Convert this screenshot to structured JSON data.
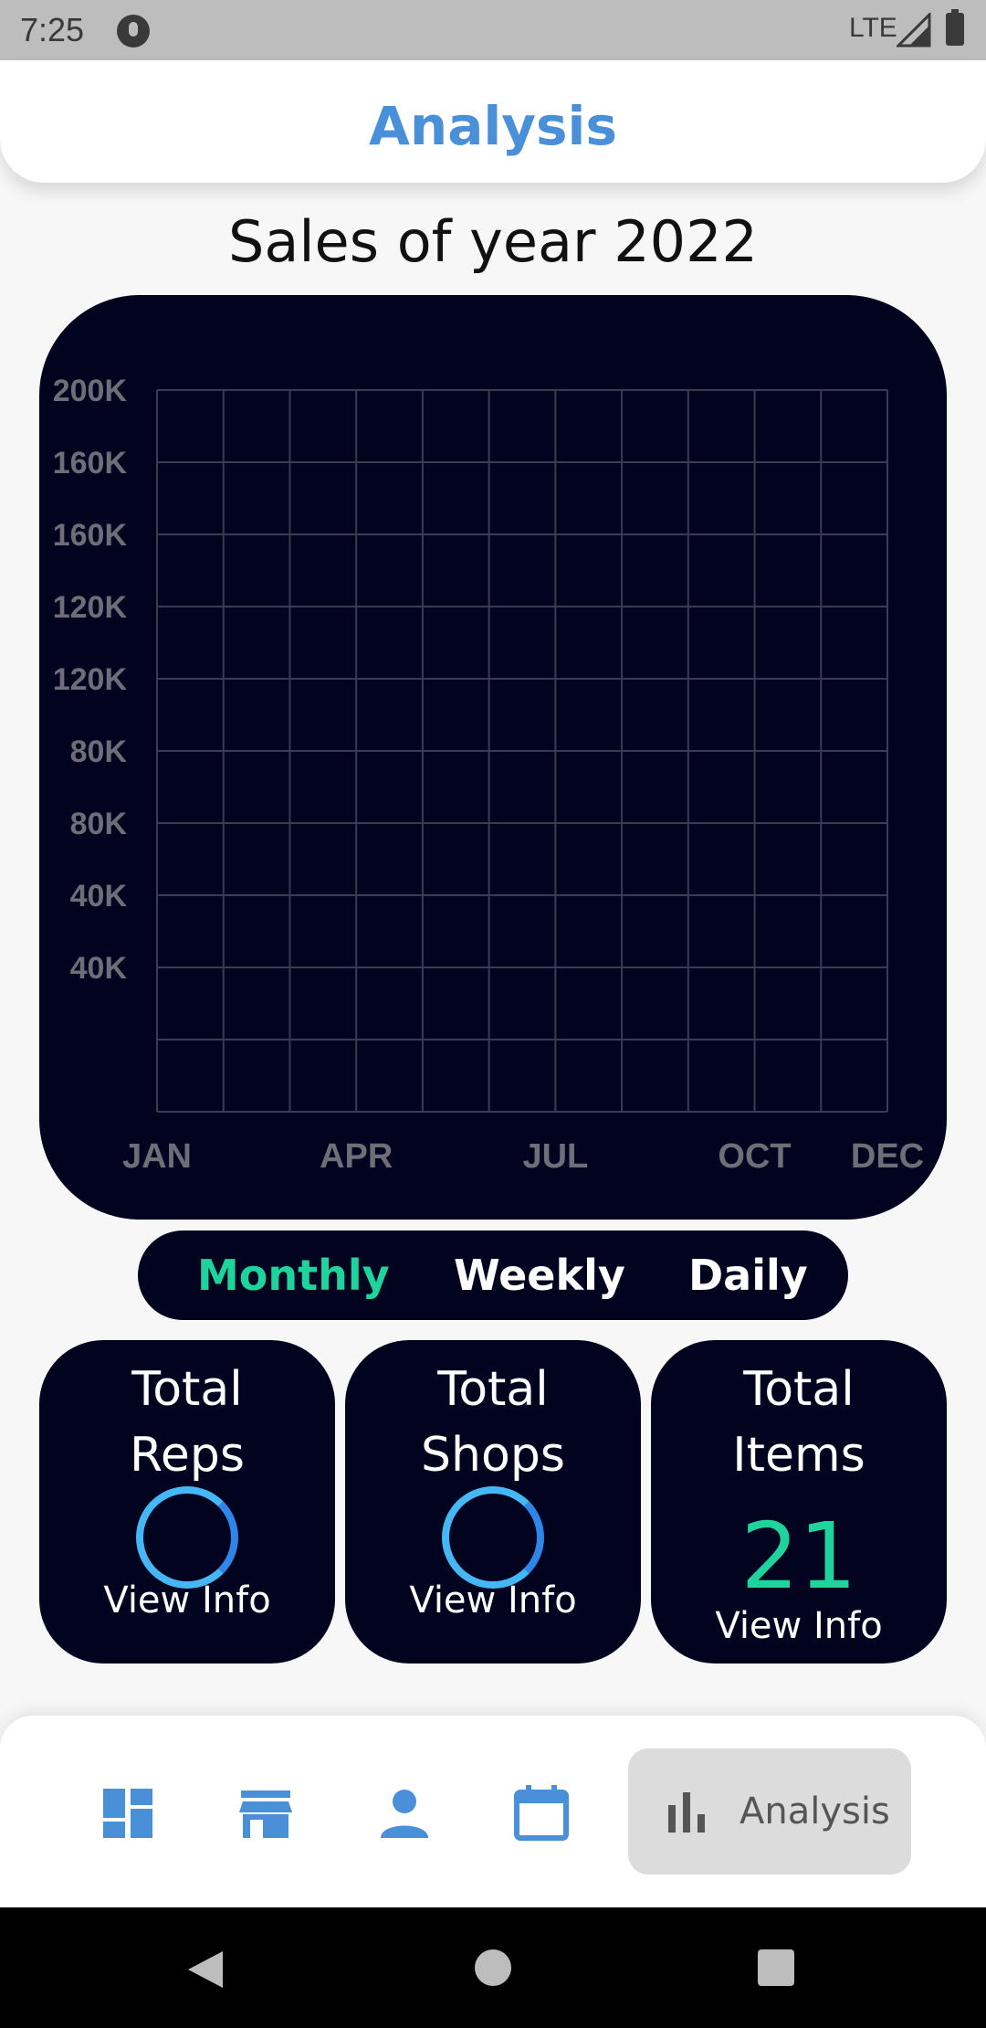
{
  "status_bar": {
    "time": "7:25",
    "network": "LTE"
  },
  "header": {
    "title": "Analysis"
  },
  "chart_data": {
    "type": "line",
    "title": "Sales of year 2022",
    "y_tick_labels": [
      "200K",
      "160K",
      "160K",
      "120K",
      "120K",
      "80K",
      "80K",
      "40K",
      "40K"
    ],
    "x_tick_labels": [
      "JAN",
      "APR",
      "JUL",
      "OCT",
      "DEC"
    ],
    "series": [],
    "grid": true
  },
  "period_toggle": {
    "options": [
      "Monthly",
      "Weekly",
      "Daily"
    ],
    "selected": "Monthly",
    "active_color": "#1fd39c"
  },
  "stats": {
    "reps": {
      "title_line1": "Total",
      "title_line2": "Reps",
      "link": "View Info",
      "loading": true
    },
    "shops": {
      "title_line1": "Total",
      "title_line2": "Shops",
      "link": "View Info",
      "loading": true
    },
    "items": {
      "title_line1": "Total",
      "title_line2": "Items",
      "value": "21",
      "link": "View Info"
    }
  },
  "bottom_nav": {
    "items": [
      {
        "icon": "dashboard-icon"
      },
      {
        "icon": "store-icon"
      },
      {
        "icon": "person-icon"
      },
      {
        "icon": "calendar-icon"
      },
      {
        "icon": "bar-chart-icon",
        "label": "Analysis",
        "active": true
      }
    ],
    "icon_color": "#4a90d9"
  }
}
